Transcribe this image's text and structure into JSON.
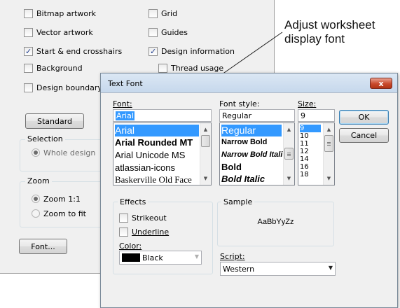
{
  "panel": {
    "checkboxes": [
      {
        "label": "Bitmap artwork",
        "checked": false
      },
      {
        "label": "Grid",
        "checked": false
      },
      {
        "label": "Vector artwork",
        "checked": false
      },
      {
        "label": "Guides",
        "checked": false
      },
      {
        "label": "Start & end crosshairs",
        "checked": true
      },
      {
        "label": "Design information",
        "checked": true
      },
      {
        "label": "Background",
        "checked": false
      },
      {
        "label": "Thread usage",
        "checked": false
      },
      {
        "label": "Design boundary",
        "checked": false
      }
    ],
    "standard_button": "Standard",
    "selection": {
      "title": "Selection",
      "option": "Whole design"
    },
    "zoom": {
      "title": "Zoom",
      "option_1": "Zoom 1:1",
      "option_2": "Zoom to fit"
    },
    "font_button": "Font..."
  },
  "callout": {
    "line1": "Adjust worksheet",
    "line2": "display font"
  },
  "dialog": {
    "title": "Text Font",
    "close_label": "x",
    "font": {
      "label": "Font:",
      "value": "Arial",
      "items": [
        "Arial",
        "Arial Rounded MT",
        "Arial Unicode MS",
        "atlassian-icons",
        "Baskerville Old Face"
      ]
    },
    "style": {
      "label": "Font style:",
      "value": "Regular",
      "items": [
        "Regular",
        "Narrow Bold",
        "Narrow Bold Itali",
        "Bold",
        "Bold Italic"
      ]
    },
    "size": {
      "label": "Size:",
      "value": "9",
      "items": [
        "9",
        "10",
        "11",
        "12",
        "14",
        "16",
        "18"
      ]
    },
    "ok": "OK",
    "cancel": "Cancel",
    "effects": {
      "title": "Effects",
      "strikeout": "Strikeout",
      "underline": "Underline",
      "color_label": "Color:",
      "color_value": "Black",
      "color_swatch": "#000000"
    },
    "sample": {
      "title": "Sample",
      "text": "AaBbYyZz"
    },
    "script": {
      "label": "Script:",
      "value": "Western"
    }
  }
}
